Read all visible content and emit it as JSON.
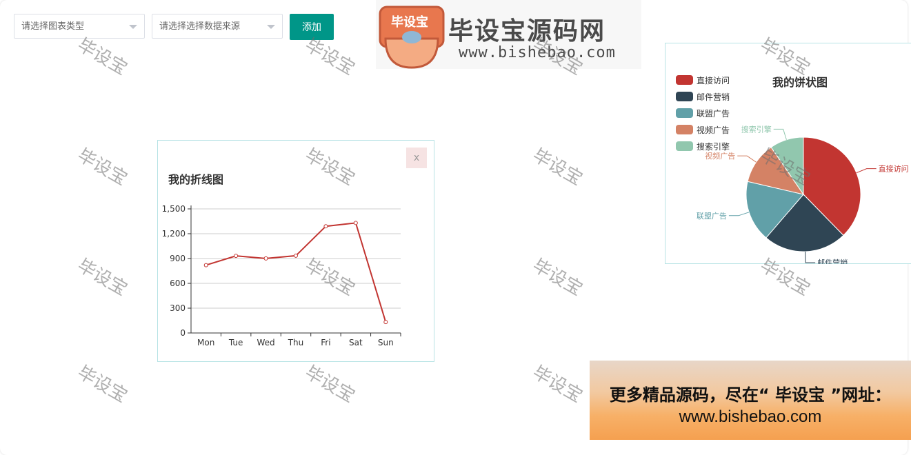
{
  "toolbar": {
    "chart_type_placeholder": "请选择图表类型",
    "data_source_placeholder": "请选择选择数据来源",
    "add_label": "添加"
  },
  "logo": {
    "badge": "毕设宝",
    "title": "毕设宝源码网",
    "url": "www.bishebao.com"
  },
  "line_panel": {
    "title": "我的折线图",
    "close_label": "x"
  },
  "pie_panel": {
    "title": "我的饼状图"
  },
  "watermark_text": "毕设宝",
  "promo": {
    "line1": "更多精品源码，尽在“ 毕设宝 ”网址：",
    "line2": "www.bishebao.com"
  },
  "chart_data": [
    {
      "type": "line",
      "title": "我的折线图",
      "categories": [
        "Mon",
        "Tue",
        "Wed",
        "Thu",
        "Fri",
        "Sat",
        "Sun"
      ],
      "series": [
        {
          "values": [
            820,
            932,
            901,
            934,
            1290,
            1330,
            132
          ],
          "color": "#c23531"
        }
      ],
      "ylim": [
        0,
        1500
      ],
      "yticks": [
        "0",
        "300",
        "600",
        "900",
        "1,200",
        "1,500"
      ],
      "grid": true
    },
    {
      "type": "pie",
      "title": "我的饼状图",
      "legend_position": "top-left",
      "slices": [
        {
          "name": "直接访问",
          "value": 335,
          "color": "#c23531"
        },
        {
          "name": "邮件营销",
          "value": 210,
          "color": "#2f4554"
        },
        {
          "name": "联盟广告",
          "value": 154,
          "color": "#61a0a8"
        },
        {
          "name": "视频广告",
          "value": 105,
          "color": "#d48265"
        },
        {
          "name": "搜索引擎",
          "value": 85,
          "color": "#91c7ae"
        }
      ]
    }
  ]
}
